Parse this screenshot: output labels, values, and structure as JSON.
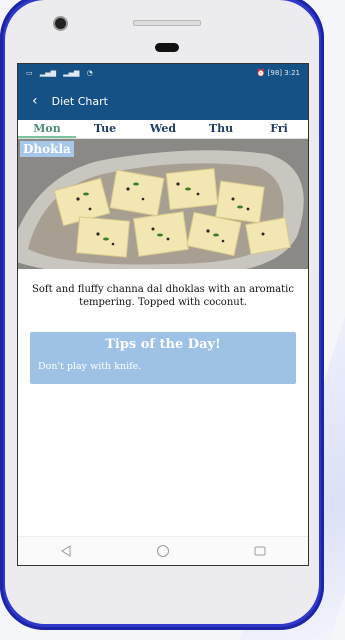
{
  "status": {
    "left_icons": [
      "sim-icon",
      "signal-icon",
      "signal-icon",
      "wifi-icon"
    ],
    "right_text": "3:21",
    "battery_label": "98"
  },
  "appbar": {
    "title": "Diet Chart"
  },
  "tabs": [
    {
      "label": "Mon",
      "active": true
    },
    {
      "label": "Tue",
      "active": false
    },
    {
      "label": "Wed",
      "active": false
    },
    {
      "label": "Thu",
      "active": false
    },
    {
      "label": "Fri",
      "active": false
    }
  ],
  "meal": {
    "name": "Dhokla",
    "description": "Soft and fluffy channa dal dhoklas with an aromatic tempering. Topped with coconut."
  },
  "tips": {
    "title": "Tips of the Day!",
    "text": "Don't play with knife."
  },
  "colors": {
    "appbar": "#155184",
    "tab_text": "#1f3c68",
    "active_tab": "#7cc3a1",
    "tips_bg": "#9ec1e6",
    "phone_frame": "#2f38c9"
  }
}
